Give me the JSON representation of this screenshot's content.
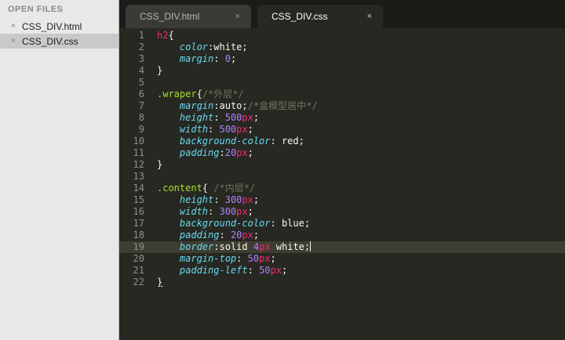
{
  "sidebar": {
    "header": "OPEN FILES",
    "files": [
      {
        "name": "CSS_DIV.html",
        "close": "×"
      },
      {
        "name": "CSS_DIV.css",
        "close": "×"
      }
    ]
  },
  "tabs": [
    {
      "label": "CSS_DIV.html",
      "close": "×"
    },
    {
      "label": "CSS_DIV.css",
      "close": "×"
    }
  ],
  "editor": {
    "current_line": 19,
    "lines": [
      {
        "n": "1",
        "t": [
          [
            "sel",
            "h2"
          ],
          [
            "punc",
            "{"
          ]
        ]
      },
      {
        "n": "2",
        "t": [
          [
            "ind",
            "    "
          ],
          [
            "prop",
            "color"
          ],
          [
            "punc",
            ":"
          ],
          [
            "val",
            "white"
          ],
          [
            "punc",
            ";"
          ]
        ]
      },
      {
        "n": "3",
        "t": [
          [
            "ind",
            "    "
          ],
          [
            "prop",
            "margin"
          ],
          [
            "punc",
            ": "
          ],
          [
            "num",
            "0"
          ],
          [
            "punc",
            ";"
          ]
        ]
      },
      {
        "n": "4",
        "t": [
          [
            "punc",
            "}"
          ]
        ]
      },
      {
        "n": "5",
        "t": []
      },
      {
        "n": "6",
        "t": [
          [
            "cls",
            ".wraper"
          ],
          [
            "punc",
            "{"
          ],
          [
            "com",
            "/*外层*/"
          ]
        ]
      },
      {
        "n": "7",
        "t": [
          [
            "ind",
            "    "
          ],
          [
            "prop",
            "margin"
          ],
          [
            "punc",
            ":"
          ],
          [
            "val",
            "auto"
          ],
          [
            "punc",
            ";"
          ],
          [
            "com",
            "/*盒模型居中*/"
          ]
        ]
      },
      {
        "n": "8",
        "t": [
          [
            "ind",
            "    "
          ],
          [
            "prop",
            "height"
          ],
          [
            "punc",
            ": "
          ],
          [
            "num",
            "500"
          ],
          [
            "unit",
            "px"
          ],
          [
            "punc",
            ";"
          ]
        ]
      },
      {
        "n": "9",
        "t": [
          [
            "ind",
            "    "
          ],
          [
            "prop",
            "width"
          ],
          [
            "punc",
            ": "
          ],
          [
            "num",
            "500"
          ],
          [
            "unit",
            "px"
          ],
          [
            "punc",
            ";"
          ]
        ]
      },
      {
        "n": "10",
        "t": [
          [
            "ind",
            "    "
          ],
          [
            "prop",
            "background-color"
          ],
          [
            "punc",
            ": "
          ],
          [
            "val",
            "red"
          ],
          [
            "punc",
            ";"
          ]
        ]
      },
      {
        "n": "11",
        "t": [
          [
            "ind",
            "    "
          ],
          [
            "prop",
            "padding"
          ],
          [
            "punc",
            ":"
          ],
          [
            "num",
            "20"
          ],
          [
            "unit",
            "px"
          ],
          [
            "punc",
            ";"
          ]
        ]
      },
      {
        "n": "12",
        "t": [
          [
            "punc",
            "}"
          ]
        ]
      },
      {
        "n": "13",
        "t": []
      },
      {
        "n": "14",
        "t": [
          [
            "cls",
            ".content"
          ],
          [
            "punc",
            "{ "
          ],
          [
            "com",
            "/*内层*/"
          ]
        ]
      },
      {
        "n": "15",
        "t": [
          [
            "ind",
            "    "
          ],
          [
            "prop",
            "height"
          ],
          [
            "punc",
            ": "
          ],
          [
            "num",
            "300"
          ],
          [
            "unit",
            "px"
          ],
          [
            "punc",
            ";"
          ]
        ]
      },
      {
        "n": "16",
        "t": [
          [
            "ind",
            "    "
          ],
          [
            "prop",
            "width"
          ],
          [
            "punc",
            ": "
          ],
          [
            "num",
            "300"
          ],
          [
            "unit",
            "px"
          ],
          [
            "punc",
            ";"
          ]
        ]
      },
      {
        "n": "17",
        "t": [
          [
            "ind",
            "    "
          ],
          [
            "prop",
            "background-color"
          ],
          [
            "punc",
            ": "
          ],
          [
            "val",
            "blue"
          ],
          [
            "punc",
            ";"
          ]
        ]
      },
      {
        "n": "18",
        "t": [
          [
            "ind",
            "    "
          ],
          [
            "prop",
            "padding"
          ],
          [
            "punc",
            ": "
          ],
          [
            "num",
            "20"
          ],
          [
            "unit",
            "px"
          ],
          [
            "punc",
            ";"
          ]
        ]
      },
      {
        "n": "19",
        "t": [
          [
            "ind",
            "    "
          ],
          [
            "prop",
            "border"
          ],
          [
            "punc",
            ":"
          ],
          [
            "val",
            "solid "
          ],
          [
            "num",
            "4"
          ],
          [
            "unit",
            "px"
          ],
          [
            "val",
            " white"
          ],
          [
            "punc",
            ";"
          ],
          [
            "caret",
            ""
          ]
        ]
      },
      {
        "n": "20",
        "t": [
          [
            "ind",
            "    "
          ],
          [
            "prop",
            "margin-top"
          ],
          [
            "punc",
            ": "
          ],
          [
            "num",
            "50"
          ],
          [
            "unit",
            "px"
          ],
          [
            "punc",
            ";"
          ]
        ]
      },
      {
        "n": "21",
        "t": [
          [
            "ind",
            "    "
          ],
          [
            "prop",
            "padding-left"
          ],
          [
            "punc",
            ": "
          ],
          [
            "num",
            "50"
          ],
          [
            "unit",
            "px"
          ],
          [
            "punc",
            ";"
          ]
        ]
      },
      {
        "n": "22",
        "t": [
          [
            "brace",
            "}"
          ]
        ]
      }
    ]
  }
}
